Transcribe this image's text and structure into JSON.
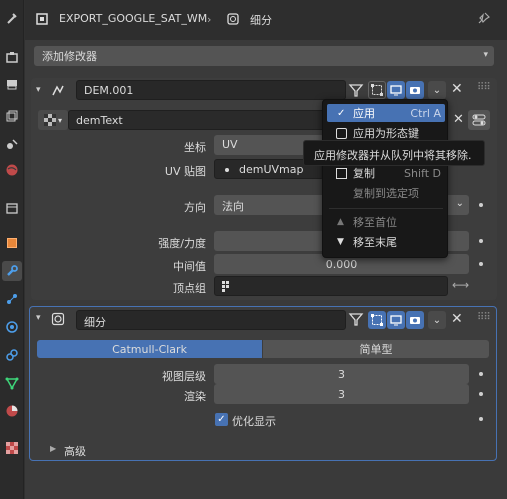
{
  "header": {
    "object_name": "EXPORT_GOOGLE_SAT_WM",
    "data_name": "细分"
  },
  "add_modifier": {
    "label": "添加修改器"
  },
  "displace": {
    "name": "DEM.001",
    "texture_name": "demText",
    "coord_label": "坐标",
    "coord_value": "UV",
    "uvmap_label": "UV 贴图",
    "uvmap_value": "demUVmap",
    "direction_label": "方向",
    "direction_value": "法向",
    "strength_label": "强度/力度",
    "midlevel_label": "中间值",
    "midlevel_value": "0.000",
    "vgroup_label": "顶点组"
  },
  "dropdown": {
    "items": [
      {
        "label": "应用",
        "shortcut": "Ctrl A",
        "selected": true
      },
      {
        "label": "应用为形态键",
        "shortcut": ""
      },
      {
        "label": "复制",
        "shortcut": "Shift D"
      },
      {
        "label": "复制到选定项",
        "shortcut": ""
      },
      {
        "label": "移至首位",
        "shortcut": ""
      },
      {
        "label": "移至末尾",
        "shortcut": ""
      }
    ]
  },
  "tooltip": {
    "text": "应用修改器并从队列中将其移除."
  },
  "subsurf": {
    "name": "细分",
    "tab_catmull": "Catmull-Clark",
    "tab_simple": "简单型",
    "viewport_label": "视图层级",
    "viewport_value": "3",
    "render_label": "渲染",
    "render_value": "3",
    "optimal_label": "优化显示",
    "advanced_label": "高级"
  },
  "colors": {
    "accent": "#4772b3",
    "panel": "#3d3d3d",
    "bg": "#303030"
  }
}
